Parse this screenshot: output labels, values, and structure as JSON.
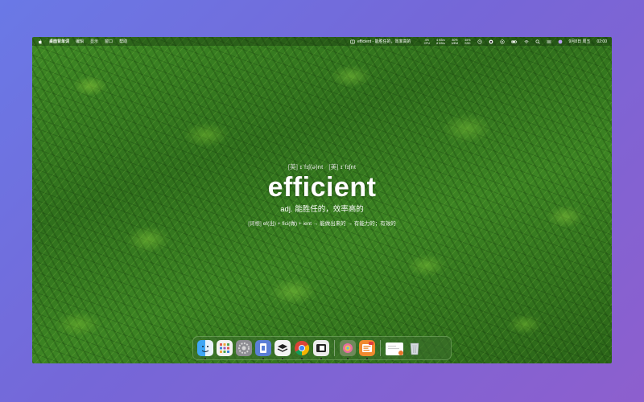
{
  "menubar": {
    "app_name": "桌面背单词",
    "menus": [
      "编辑",
      "显示",
      "窗口",
      "帮助"
    ],
    "now_showing": "efficient - 能胜任的，效率高的",
    "stats": [
      {
        "top": "4%",
        "bottom": "CPU"
      },
      {
        "top": "4 KB/s",
        "bottom": "8 KB/s"
      },
      {
        "top": "80%",
        "bottom": "MEM"
      },
      {
        "top": "45%",
        "bottom": "SSD"
      }
    ],
    "date": "9月8日 周五",
    "time": "02:00",
    "icons": [
      "apple-icon",
      "book-icon",
      "clock-icon",
      "gauge-icon",
      "record-icon",
      "battery-icon",
      "wifi-icon",
      "search-icon",
      "control-center-icon",
      "siri-icon"
    ]
  },
  "word": {
    "phonetic_uk_tag": "[英]",
    "phonetic_uk": "ɪˈfɪʃ(ə)nt",
    "phonetic_us_tag": "[美]",
    "phonetic_us": "ɪˈfɪʃnt",
    "headword": "efficient",
    "definition": "adj. 能胜任的，效率高的",
    "etymology_tag": "[词根]",
    "etymology": "ef(出) + fici(做) + ient → 能做出来的 → 有能力的；有效的"
  },
  "dock": {
    "apps": [
      "finder-icon",
      "launchpad-icon",
      "system-settings-icon",
      "files-icon",
      "stack-icon",
      "chrome-icon",
      "window-icon",
      "photos-icon",
      "dictionary-app-icon"
    ],
    "recent": [
      "document-icon",
      "trash-icon"
    ]
  },
  "colors": {
    "background_start": "#6a79e6",
    "background_end": "#8d5fce",
    "foliage": "#3f8a25"
  }
}
